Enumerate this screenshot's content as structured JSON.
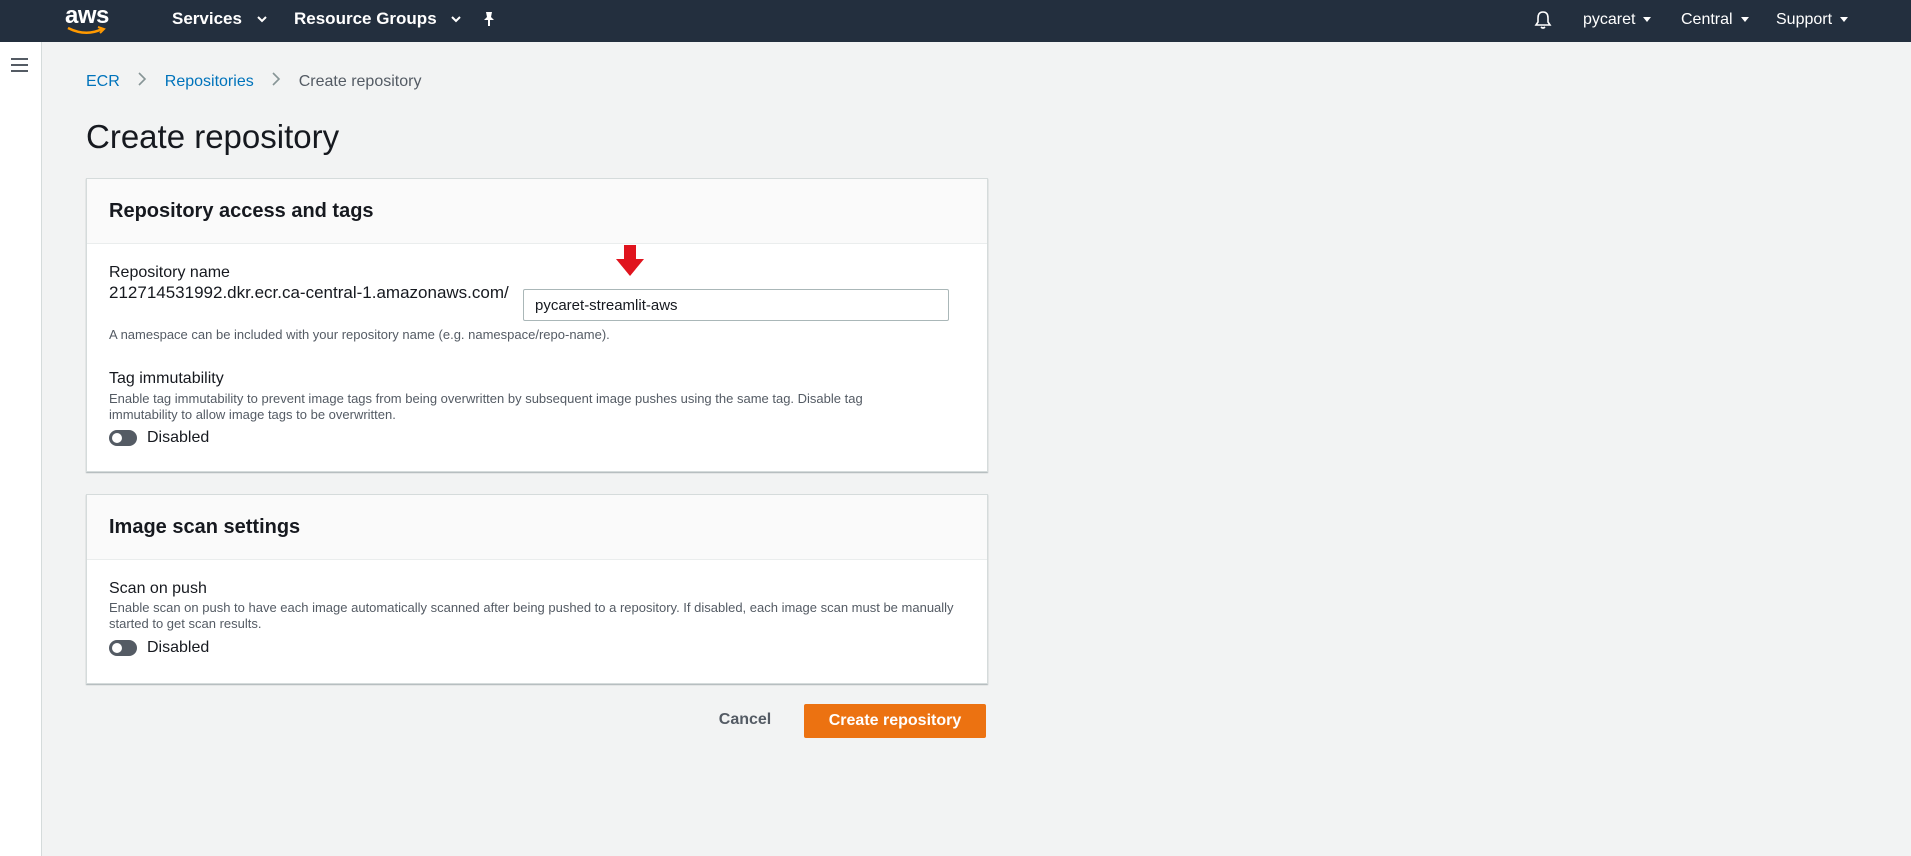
{
  "topnav": {
    "logo_text": "aws",
    "services_label": "Services",
    "resource_groups_label": "Resource Groups",
    "account_label": "pycaret",
    "region_label": "Central",
    "support_label": "Support"
  },
  "breadcrumb": {
    "items": [
      "ECR",
      "Repositories",
      "Create repository"
    ]
  },
  "page": {
    "title": "Create repository"
  },
  "panel_access": {
    "title": "Repository access and tags",
    "repo_name_label": "Repository name",
    "uri_prefix": "212714531992.dkr.ecr.ca-central-1.amazonaws.com/",
    "repo_name_value": "pycaret-streamlit-aws",
    "repo_name_hint": "A namespace can be included with your repository name (e.g. namespace/repo-name).",
    "tag_immutability_label": "Tag immutability",
    "tag_immutability_desc": "Enable tag immutability to prevent image tags from being overwritten by subsequent image pushes using the same tag. Disable tag immutability to allow image tags to be overwritten.",
    "tag_immutability_state": "Disabled"
  },
  "panel_scan": {
    "title": "Image scan settings",
    "scan_on_push_label": "Scan on push",
    "scan_on_push_desc": "Enable scan on push to have each image automatically scanned after being pushed to a repository. If disabled, each image scan must be manually started to get scan results.",
    "scan_on_push_state": "Disabled"
  },
  "actions": {
    "cancel_label": "Cancel",
    "create_label": "Create repository"
  },
  "colors": {
    "nav_bg": "#232f3e",
    "primary_button": "#ec7211",
    "link": "#0073bb",
    "annotation_arrow": "#e0141e"
  }
}
